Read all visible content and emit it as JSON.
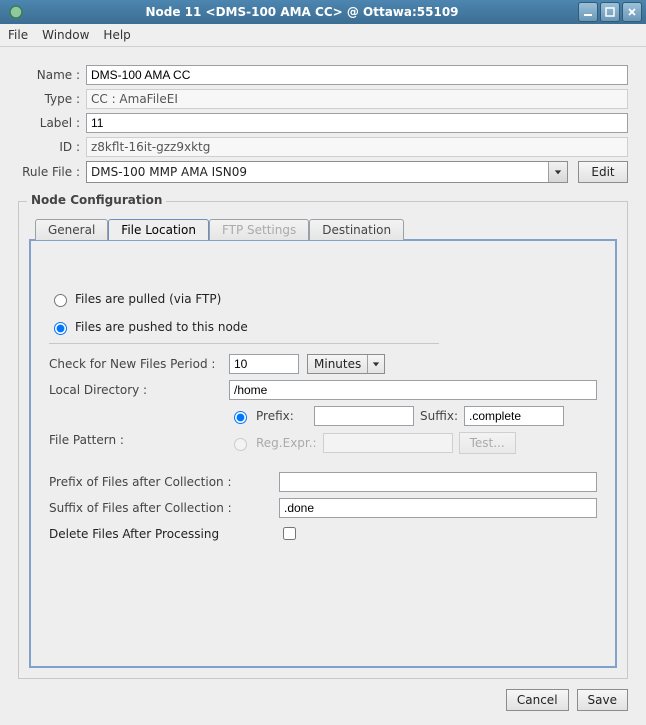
{
  "titlebar": {
    "title": "Node 11 <DMS-100 AMA CC> @ Ottawa:55109"
  },
  "menubar": {
    "file": "File",
    "window": "Window",
    "help": "Help"
  },
  "fields": {
    "name_label": "Name :",
    "name_value": "DMS-100 AMA CC",
    "type_label": "Type :",
    "type_value": "CC : AmaFileEI",
    "label_label": "Label :",
    "label_value": "11",
    "id_label": "ID :",
    "id_value": "z8kflt-16it-gzz9xktg",
    "rulefile_label": "Rule File :",
    "rulefile_value": "DMS-100 MMP AMA ISN09",
    "edit_btn": "Edit"
  },
  "fieldset": {
    "legend": "Node Configuration"
  },
  "tabs": {
    "general": "General",
    "file_location": "File Location",
    "ftp_settings": "FTP Settings",
    "destination": "Destination"
  },
  "file_loc": {
    "pull_radio": "Files are pulled (via FTP)",
    "push_radio": "Files are pushed to this node",
    "check_period_label": "Check for New Files Period :",
    "check_period_value": "10",
    "check_period_unit": "Minutes",
    "local_dir_label": "Local Directory :",
    "local_dir_value": "/home",
    "pattern_label": "File Pattern :",
    "prefix_label": "Prefix:",
    "prefix_value": "",
    "suffix_label": "Suffix:",
    "suffix_value": ".complete",
    "regexpr_label": "Reg.Expr.:",
    "regexpr_value": "",
    "test_btn": "Test...",
    "prefix_after_label": "Prefix of Files after Collection :",
    "prefix_after_value": "",
    "suffix_after_label": "Suffix of Files after Collection :",
    "suffix_after_value": ".done",
    "delete_label": "Delete Files After Processing"
  },
  "footer": {
    "cancel": "Cancel",
    "save": "Save"
  }
}
